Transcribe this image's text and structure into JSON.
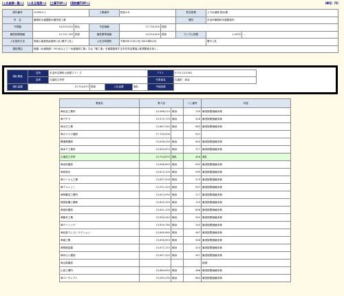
{
  "nav": {
    "links": [
      "(入札結果一覧へ)",
      "(入札日程表へ)",
      "(工事TOPへ)",
      "(契約課TOPへ)"
    ],
    "unit": "(単位：円)"
  },
  "info": {
    "r1": {
      "l1": "案件番号",
      "v1": "103943-1",
      "l2": "工事番号",
      "v2": "配区4-8",
      "l3": "担当部課",
      "v3": "上下水道部 配水課"
    },
    "r2": {
      "l1": "件　名",
      "v1": "横島町水道整配水管改良工事",
      "l2": "場所",
      "v2": "宇治市横島町水道整地内"
    },
    "r3": {
      "l1": "予算額",
      "v1": "18,503,000",
      "t1": "税込",
      "l2": "予定価格",
      "v2": "17,730,000",
      "t2": "税抜"
    },
    "r4": {
      "l1": "最低制限価格",
      "v1": "15,701,760",
      "t1": "税抜",
      "l2": "最低基準価格",
      "v2": "15,554,000",
      "t2": "税抜",
      "l3": "ランダム係数",
      "v3": "1.0095",
      "v4": "---"
    },
    "r5": {
      "l1": "入札契約方法",
      "v1": "簡易公募型指名競争入札(電子入札)",
      "l2": "入札日時場所",
      "v2": "令和4年11月15日 AM10時30分",
      "v3": "電子入札"
    },
    "r6": {
      "l1": "選定理由",
      "v1": "総額（水道施設）500点以上で「水道施設工事」又は「管工事」を最高登録する市内本店業者◎新規業者を除く。"
    }
  },
  "winner": {
    "l_winner": "落札業者",
    "l_addr": "住所",
    "addr": "宇治市広野町小桃尾２３－２",
    "l_tel": "ＴＥＬ",
    "tel": "0774-23-5561",
    "l_name": "名称",
    "name": "久保田工作所",
    "l_rep": "代表者名",
    "rep": "久保田　幸治",
    "l_amount": "落札金額",
    "amount": "15,704,870",
    "tax": "税抜",
    "l_result": "入札結果",
    "result": "落札",
    "l_invalid": "不納結果"
  },
  "bids": {
    "headers": [
      "業者名",
      "第１回",
      "くじ番号",
      "判定"
    ],
    "rows": [
      {
        "name": "㈱北谷工業所",
        "amount": "15,588,210",
        "tax": "無効",
        "lot": "709",
        "verdict": "最低制限価格未満"
      },
      {
        "name": "㈱ウチラ",
        "amount": "15,575,770",
        "tax": "無効",
        "lot": "916",
        "verdict": "最低制限価格未満"
      },
      {
        "name": "㈱大日工業",
        "amount": "15,667,540",
        "tax": "無効",
        "lot": "663",
        "verdict": "最低制限価格未満"
      },
      {
        "name": "㈱カナヤマ建設",
        "amount": "17,700,000",
        "tax": "",
        "lot": "921",
        "verdict": ""
      },
      {
        "name": "関浦興業㈱",
        "amount": "15,636,430",
        "tax": "無効",
        "lot": "890",
        "verdict": "最低制限価格未満"
      },
      {
        "name": "㈱木下工業所",
        "amount": "15,690,870",
        "tax": "無効",
        "lot": "377",
        "verdict": "最低制限価格未満"
      },
      {
        "name": "久保田工作所",
        "amount": "15,704,870",
        "tax": "落札",
        "lot": "446",
        "verdict": "落札",
        "win": true
      },
      {
        "name": "㈱余田建設",
        "amount": "15,698,650",
        "tax": "無効",
        "lot": "635",
        "verdict": "最低制限価格未満"
      },
      {
        "name": "㈱双和元",
        "amount": "15,613,100",
        "tax": "無効",
        "lot": "999",
        "verdict": "最低制限価格未満"
      },
      {
        "name": "㈱ジーエム工業",
        "amount": "15,697,000",
        "tax": "無効",
        "lot": "579",
        "verdict": "最低制限価格未満"
      },
      {
        "name": "㈱Ｔｓｕｊｉ",
        "amount": "15,591,320",
        "tax": "無効",
        "lot": "997",
        "verdict": "最低制限価格未満"
      },
      {
        "name": "㈱阿蘇名工業所",
        "amount": "15,623,990",
        "tax": "無効",
        "lot": "117",
        "verdict": "最低制限価格未満"
      },
      {
        "name": "能勢設備工業㈱",
        "amount": "15,605,320",
        "tax": "無効",
        "lot": "119",
        "verdict": "最低制限価格未満"
      },
      {
        "name": "㈱浪米建設",
        "amount": "15,641,100",
        "tax": "無効",
        "lot": "808",
        "verdict": "最低制限価格未満"
      },
      {
        "name": "㈱藤本工業",
        "amount": "15,639,540",
        "tax": "無効",
        "lot": "955",
        "verdict": "最低制限価格未満"
      },
      {
        "name": "㈱ベーシック",
        "amount": "15,659,760",
        "tax": "無効",
        "lot": "263",
        "verdict": "最低制限価格未満"
      },
      {
        "name": "㈱北部コンストラクション",
        "amount": "15,680,660",
        "tax": "無効",
        "lot": "467",
        "verdict": "最低制限価格未満"
      },
      {
        "name": "㈱南工業",
        "amount": "15,656,650",
        "tax": "無効",
        "lot": "908",
        "verdict": "最低制限価格未満"
      },
      {
        "name": "㈱明進技建",
        "amount": "15,672,210",
        "tax": "無効",
        "lot": "424",
        "verdict": "最低制限価格未満"
      },
      {
        "name": "㈱みらい建設",
        "amount": "15,647,320",
        "tax": "無効",
        "lot": "947",
        "verdict": "最低制限価格未満"
      },
      {
        "name": "㈱山原建設",
        "amount": "",
        "tax": "",
        "lot": "",
        "verdict": "辞退"
      },
      {
        "name": "山田工業所",
        "amount": "15,684,650",
        "tax": "無効",
        "lot": "466",
        "verdict": "最低制限価格未満"
      },
      {
        "name": "㈱ユーディアイ",
        "amount": "15,563,330",
        "tax": "無効",
        "lot": "864",
        "verdict": "最低制限価格未満"
      }
    ]
  }
}
